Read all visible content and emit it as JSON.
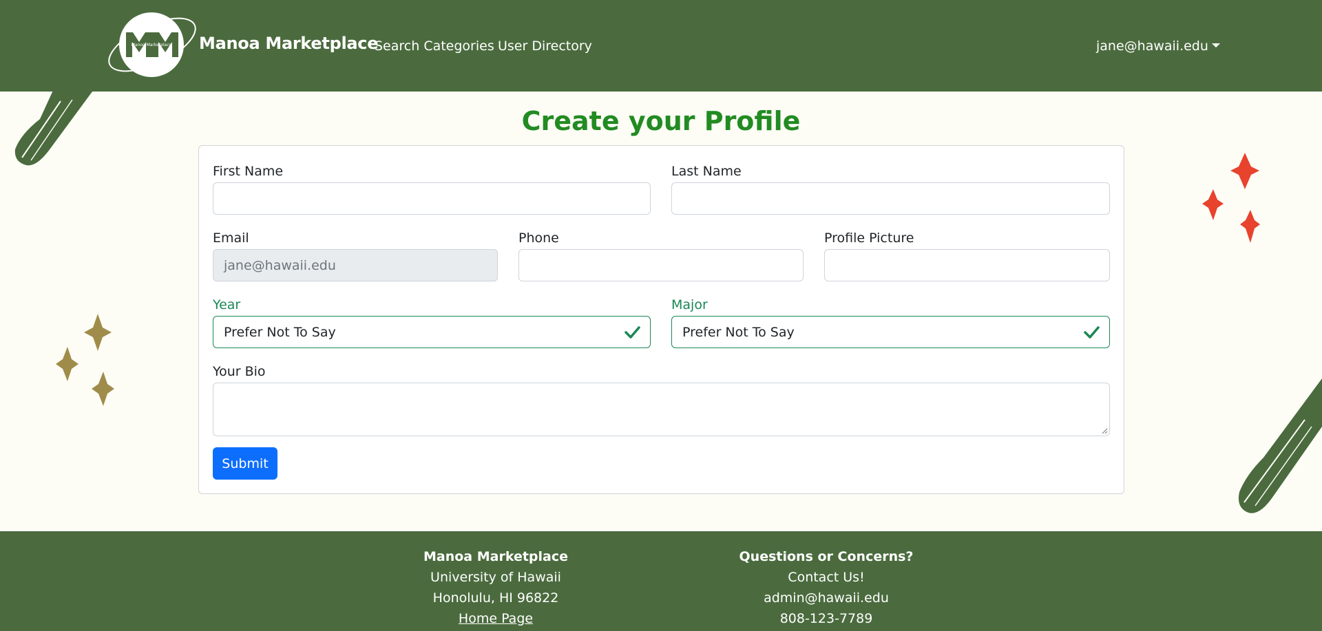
{
  "navbar": {
    "logo_text": "Manoa Marketplace",
    "brand": "Manoa Marketplace",
    "links": [
      "Search Categories",
      "User Directory"
    ],
    "user": "jane@hawaii.edu"
  },
  "page_title": "Create your Profile",
  "form": {
    "first_name": {
      "label": "First Name",
      "value": ""
    },
    "last_name": {
      "label": "Last Name",
      "value": ""
    },
    "email": {
      "label": "Email",
      "value": "jane@hawaii.edu"
    },
    "phone": {
      "label": "Phone",
      "value": ""
    },
    "profile_picture": {
      "label": "Profile Picture",
      "value": ""
    },
    "year": {
      "label": "Year",
      "value": "Prefer Not To Say"
    },
    "major": {
      "label": "Major",
      "value": "Prefer Not To Say"
    },
    "bio": {
      "label": "Your Bio",
      "value": ""
    },
    "submit_label": "Submit"
  },
  "footer": {
    "left": {
      "heading": "Manoa Marketplace",
      "line1": "University of Hawaii",
      "line2": "Honolulu, HI 96822",
      "link": "Home Page"
    },
    "right": {
      "heading": "Questions or Concerns?",
      "line1": "Contact Us!",
      "line2": "admin@hawaii.edu",
      "line3": "808-123-7789"
    }
  },
  "colors": {
    "navbar_bg": "#4b6b3e",
    "title": "#228b22",
    "primary_button": "#0d6efd",
    "valid": "#198754",
    "sparkle_red": "#e8432d",
    "sparkle_gold": "#a08c4a"
  },
  "icons": [
    "logo-icon",
    "caret-down-icon",
    "check-icon",
    "sparkle-icon",
    "brush-stroke-icon"
  ]
}
